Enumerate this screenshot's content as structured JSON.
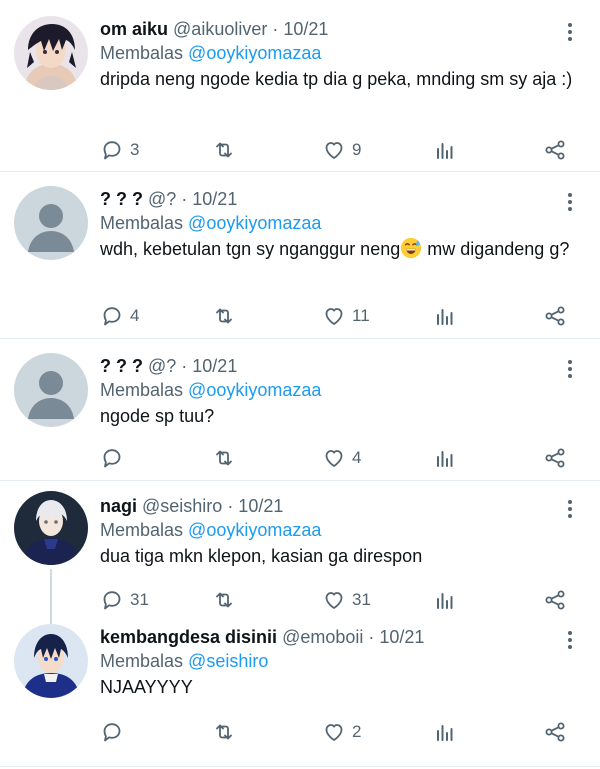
{
  "tweets": [
    {
      "name": "om aiku",
      "meta": "@aikuoliver · 10/21",
      "replying_prefix": "Membalas",
      "replying_to": "@ooykiyomazaa",
      "text": "dripda neng ngode kedia tp dia g peka, mnding sm sy aja :)",
      "emoji_after": "",
      "text_after": "",
      "replies": "3",
      "retweets": "",
      "likes": "9",
      "avatar": "anime-dark-hair"
    },
    {
      "name": "? ? ?",
      "meta": "@? · 10/21",
      "replying_prefix": "Membalas",
      "replying_to": "@ooykiyomazaa",
      "text": "wdh, kebetulan tgn sy nganggur neng",
      "emoji_after": "grinning-sweat-emoji",
      "text_after": " mw digandeng g?",
      "replies": "4",
      "retweets": "",
      "likes": "11",
      "avatar": "default-profile"
    },
    {
      "name": "? ? ?",
      "meta": "@? · 10/21",
      "replying_prefix": "Membalas",
      "replying_to": "@ooykiyomazaa",
      "text": "ngode sp tuu?",
      "emoji_after": "",
      "text_after": "",
      "replies": "",
      "retweets": "",
      "likes": "4",
      "avatar": "default-profile"
    },
    {
      "name": "nagi",
      "meta": "@seishiro · 10/21",
      "replying_prefix": "Membalas",
      "replying_to": "@ooykiyomazaa",
      "text": "dua tiga mkn klepon, kasian ga direspon",
      "emoji_after": "",
      "text_after": "",
      "replies": "31",
      "retweets": "",
      "likes": "31",
      "avatar": "anime-white-hair"
    },
    {
      "name": "kembangdesa disinii",
      "meta": "@emoboii · 10/21",
      "replying_prefix": "Membalas",
      "replying_to": "@seishiro",
      "text": "NJAAYYYY",
      "emoji_after": "",
      "text_after": "",
      "replies": "",
      "retweets": "",
      "likes": "2",
      "avatar": "anime-blue-hair"
    }
  ],
  "colors": {
    "accent": "#1d9bf0",
    "secondary_text": "#536471",
    "divider": "#e6ecf0",
    "default_avatar_bg": "#ccd6dd",
    "default_avatar_fg": "#7b8a97"
  },
  "icons": {
    "reply": "reply-icon",
    "retweet": "retweet-icon",
    "like": "heart-icon",
    "views": "views-icon",
    "share": "share-icon",
    "more": "more-vertical-icon"
  }
}
